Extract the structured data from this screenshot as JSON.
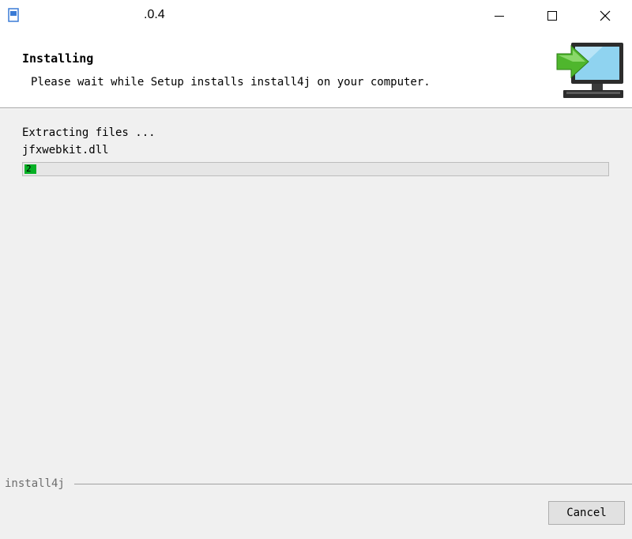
{
  "window": {
    "title": ".0.4",
    "app_icon": "installer-app-icon",
    "controls": {
      "minimize": "minimize-icon",
      "maximize": "maximize-icon",
      "close": "close-icon"
    }
  },
  "header": {
    "title": "Installing",
    "subtitle": "Please wait while Setup installs install4j on your computer.",
    "icon": "computer-install-arrow-icon"
  },
  "progress": {
    "status": "Extracting files ...",
    "current_file": "jfxwebkit.dll",
    "percent_label": "2",
    "fraction": 0.02,
    "fill_color": "#06b025"
  },
  "footer": {
    "brand": "install4j",
    "cancel_label": "Cancel"
  }
}
